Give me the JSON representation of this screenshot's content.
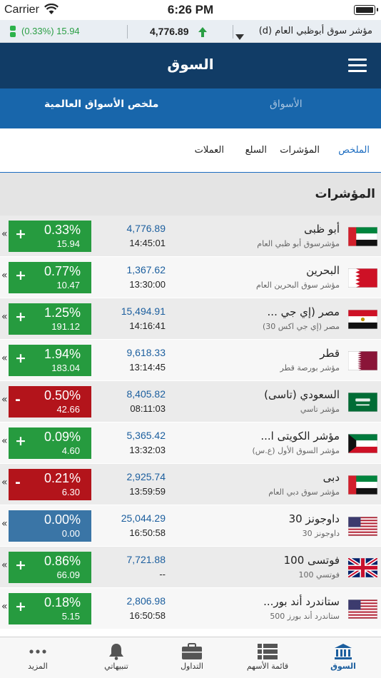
{
  "status_bar": {
    "carrier": "Carrier",
    "time": "6:26 PM"
  },
  "ticker": {
    "change": "(0.33%) 15.94",
    "value": "4,776.89",
    "name": "مؤشر سوق أبوظبي العام (d)"
  },
  "header": {
    "title": "السوق"
  },
  "subnav": {
    "items": [
      "ملخص الأسواق العالمية",
      "الأسواق"
    ]
  },
  "tabs": {
    "items": [
      "الملخص",
      "المؤشرات",
      "السلع",
      "العملات"
    ]
  },
  "section": {
    "title": "المؤشرات"
  },
  "markets": [
    {
      "name": "أبو ظبى",
      "sub": "مؤشرسوق أبو ظبي العام",
      "value": "4,776.89",
      "time": "14:45:01",
      "pct": "0.33%",
      "pts": "15.94",
      "sign": "+",
      "dir": "up",
      "flag": "uae"
    },
    {
      "name": "البحرين",
      "sub": "مؤشر سوق البحرين العام",
      "value": "1,367.62",
      "time": "13:30:00",
      "pct": "0.77%",
      "pts": "10.47",
      "sign": "+",
      "dir": "up",
      "flag": "bahrain"
    },
    {
      "name": "مصر (إي جي ...",
      "sub": "مصر (إي جي اكس 30)",
      "value": "15,494.91",
      "time": "14:16:41",
      "pct": "1.25%",
      "pts": "191.12",
      "sign": "+",
      "dir": "up",
      "flag": "egypt"
    },
    {
      "name": "قطر",
      "sub": "مؤشر بورصة قطر",
      "value": "9,618.33",
      "time": "13:14:45",
      "pct": "1.94%",
      "pts": "183.04",
      "sign": "+",
      "dir": "up",
      "flag": "qatar"
    },
    {
      "name": "السعودي (تاسى)",
      "sub": "مؤشر تاسي",
      "value": "8,405.82",
      "time": "08:11:03",
      "pct": "0.50%",
      "pts": "42.66",
      "sign": "-",
      "dir": "down",
      "flag": "saudi"
    },
    {
      "name": "مؤشر الكويتى ا...",
      "sub": "مؤشر السوق الأول (ع.س)",
      "value": "5,365.42",
      "time": "13:32:03",
      "pct": "0.09%",
      "pts": "4.60",
      "sign": "+",
      "dir": "up",
      "flag": "kuwait"
    },
    {
      "name": "دبى",
      "sub": "مؤشر سوق دبي العام",
      "value": "2,925.74",
      "time": "13:59:59",
      "pct": "0.21%",
      "pts": "6.30",
      "sign": "-",
      "dir": "down",
      "flag": "uae"
    },
    {
      "name": "داوجونز 30",
      "sub": "داوجونز 30",
      "value": "25,044.29",
      "time": "16:50:58",
      "pct": "0.00%",
      "pts": "0.00",
      "sign": "",
      "dir": "flat",
      "flag": "usa"
    },
    {
      "name": "فوتسى 100",
      "sub": "فوتسي 100",
      "value": "7,721.88",
      "time": "--",
      "pct": "0.86%",
      "pts": "66.09",
      "sign": "+",
      "dir": "up",
      "flag": "uk"
    },
    {
      "name": "ستاندرد أند بور...",
      "sub": "ستاندرد أند بورز 500",
      "value": "2,806.98",
      "time": "16:50:58",
      "pct": "0.18%",
      "pts": "5.15",
      "sign": "+",
      "dir": "up",
      "flag": "usa"
    }
  ],
  "tabbar": {
    "items": [
      {
        "label": "السوق",
        "icon": "bank-icon",
        "active": true
      },
      {
        "label": "قائمة الأسهم",
        "icon": "list-icon",
        "active": false
      },
      {
        "label": "التداول",
        "icon": "briefcase-icon",
        "active": false
      },
      {
        "label": "تنبيهاتي",
        "icon": "bell-icon",
        "active": false
      },
      {
        "label": "المزيد",
        "icon": "more-icon",
        "active": false
      }
    ]
  },
  "colors": {
    "header": "#113c66",
    "subnav": "#1866ab",
    "up": "#269b3f",
    "down": "#b3141b",
    "flat": "#3a75a6",
    "accent": "#1b6cc0"
  }
}
